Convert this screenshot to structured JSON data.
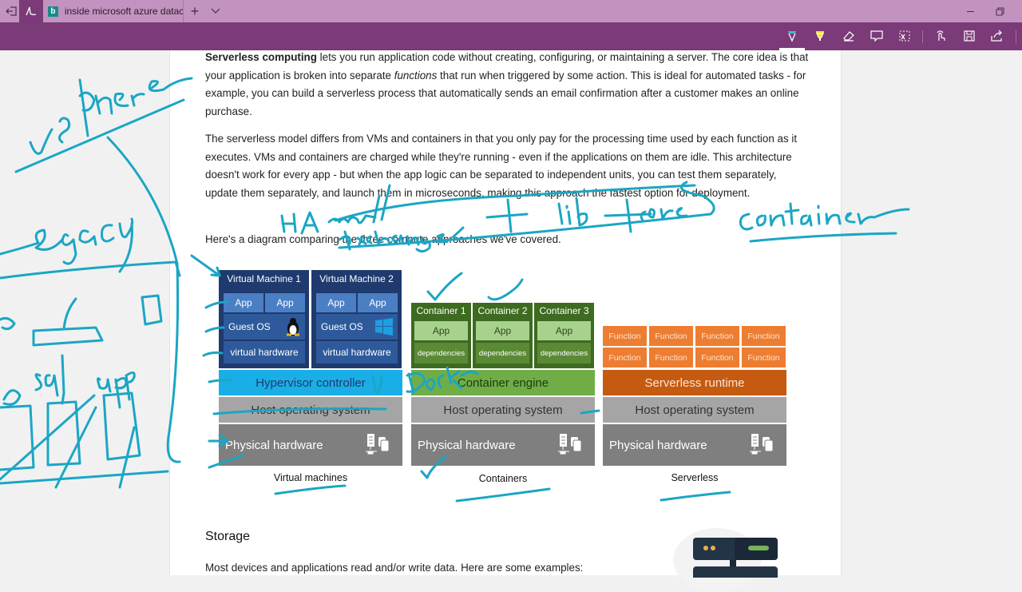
{
  "window": {
    "tab_title": "inside microsoft azure datac",
    "icons": {
      "back_to_tabs": "set-aside-icon",
      "ink_tab": "pen-icon",
      "new_tab": "plus-icon",
      "tab_list": "chevron-down-icon",
      "minimize": "minimize-icon",
      "restore": "restore-icon"
    }
  },
  "toolbar": {
    "tools": [
      {
        "name": "ballpoint-pen",
        "icon": "pen-icon",
        "color": "#3fb8d6",
        "active": true
      },
      {
        "name": "highlighter",
        "icon": "highlighter-icon",
        "color": "#f5e03a"
      },
      {
        "name": "eraser",
        "icon": "eraser-icon"
      },
      {
        "name": "add-note",
        "icon": "comment-icon"
      },
      {
        "name": "clip",
        "icon": "clip-icon"
      },
      {
        "name": "touch-writing",
        "icon": "touch-icon"
      },
      {
        "name": "save",
        "icon": "save-icon"
      },
      {
        "name": "share",
        "icon": "share-icon"
      }
    ]
  },
  "article": {
    "p1_bold": "Serverless computing",
    "p1_a": " lets you run application code without creating, configuring, or maintaining a server. The core idea is that your application is broken into separate ",
    "p1_em": "functions",
    "p1_b": " that run when triggered by some action. This is ideal for automated tasks - for example, you can build a serverless process that automatically sends an email confirmation after a customer makes an online purchase.",
    "p2": "The serverless model differs from VMs and containers in that you only pay for the processing time used by each function as it executes. VMs and containers are charged while they're running - even if the applications on them are idle. This architecture doesn't work for every app - but when the app logic can be separated to independent units, you can test them separately, update them separately, and launch them in microseconds, making this approach the fastest option for deployment.",
    "p3": "Here's a diagram comparing the three compute approaches we've covered.",
    "storage_heading": "Storage",
    "p4": "Most devices and applications read and/or write data. Here are some examples:"
  },
  "diagram": {
    "vm": {
      "caption": "Virtual machines",
      "machines": [
        {
          "title": "Virtual Machine 1",
          "apps": [
            "App",
            "App"
          ],
          "os": "Guest OS",
          "os_icon": "linux-penguin-icon",
          "hw": "virtual hardware"
        },
        {
          "title": "Virtual Machine 2",
          "apps": [
            "App",
            "App"
          ],
          "os": "Guest OS",
          "os_icon": "windows-logo-icon",
          "hw": "virtual hardware"
        }
      ],
      "layer": "Hypervisor controller",
      "host": "Host operating system",
      "physical": "Physical hardware"
    },
    "containers": {
      "caption": "Containers",
      "items": [
        {
          "title": "Container 1",
          "app": "App",
          "deps": "dependencies"
        },
        {
          "title": "Container 2",
          "app": "App",
          "deps": "dependencies"
        },
        {
          "title": "Container 3",
          "app": "App",
          "deps": "dependencies"
        }
      ],
      "layer": "Container engine",
      "host": "Host operating system",
      "physical": "Physical hardware"
    },
    "serverless": {
      "caption": "Serverless",
      "functions": [
        "Function",
        "Function",
        "Function",
        "Function",
        "Function",
        "Function",
        "Function",
        "Function"
      ],
      "layer": "Serverless runtime",
      "host": "Host operating system",
      "physical": "Physical hardware"
    },
    "colors": {
      "vm_dark": "#1f3a6e",
      "vm_mid": "#2e5a9c",
      "vm_light": "#4b7fc4",
      "hypervisor": "#1aaee6",
      "ct_dark": "#3d6b1f",
      "ct_light": "#a9d18e",
      "ct_deps": "#5b8a36",
      "engine": "#70ad47",
      "fn": "#ed7d31",
      "runtime": "#c55a11",
      "host": "#a5a5a5",
      "physical": "#7f7f7f"
    }
  },
  "ink_annotations": [
    "vsphere",
    "legacy",
    "sql",
    "app",
    "HA",
    "mail",
    "exchange",
    "+ lib + core",
    "container",
    "Docker"
  ]
}
